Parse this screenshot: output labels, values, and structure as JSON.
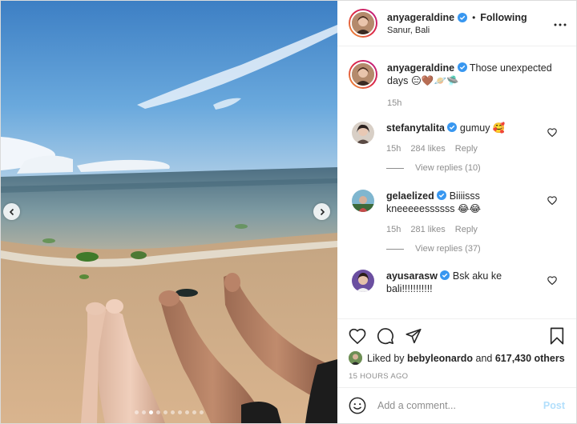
{
  "post": {
    "username": "anyageraldine",
    "follow_status": "Following",
    "separator": "•",
    "location": "Sanur, Bali",
    "more_icon": "more-horizontal-icon"
  },
  "caption": {
    "username": "anyageraldine",
    "text": "Those unexpected days 😑🤎🪐🛸",
    "time": "15h"
  },
  "comments": [
    {
      "username": "stefanytalita",
      "text": "gumuy 🥰",
      "time": "15h",
      "likes": "284 likes",
      "reply": "Reply",
      "view_replies": "View replies (10)"
    },
    {
      "username": "gelaelized",
      "text": "Biiiisss kneeeeessssss 😂😂",
      "time": "15h",
      "likes": "281 likes",
      "reply": "Reply",
      "view_replies": "View replies (37)"
    },
    {
      "username": "ayusarasw",
      "text": "Bsk aku ke bali!!!!!!!!!!!"
    }
  ],
  "likes": {
    "prefix": "Liked by",
    "user": "bebyleonardo",
    "and": "and",
    "others": "617,430 others"
  },
  "timestamp": "15 HOURS AGO",
  "add_comment": {
    "placeholder": "Add a comment...",
    "post_label": "Post"
  },
  "carousel": {
    "total": 10,
    "active_index": 2
  },
  "colors": {
    "verified": "#3897f0",
    "post_disabled": "#b2dffc",
    "secondary_text": "#8e8e8e"
  }
}
